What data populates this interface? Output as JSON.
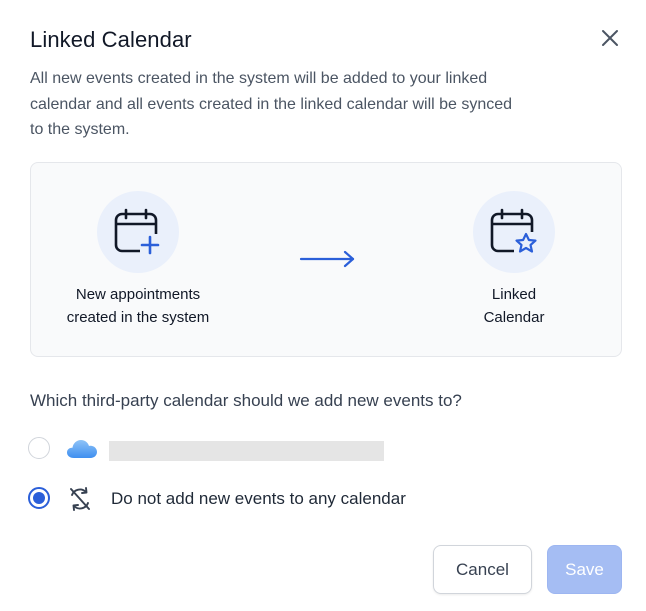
{
  "dialog": {
    "title": "Linked Calendar",
    "close_icon": "close-icon",
    "description_lines": [
      "All new events created in the system will be added to your linked",
      "calendar and all events created in the linked calendar will be synced",
      "to the system."
    ]
  },
  "flow": {
    "source_icon": "calendar-plus-icon",
    "source_label_lines": [
      "New appointments",
      "created in the system"
    ],
    "arrow_icon": "arrow-right-icon",
    "target_icon": "calendar-star-icon",
    "target_label_lines": [
      "Linked",
      "Calendar"
    ]
  },
  "calendar_choice": {
    "question": "Which third-party calendar should we add new events to?",
    "options": [
      {
        "icon": "icloud-icon",
        "label": "",
        "selected": false
      },
      {
        "icon": "sync-off-icon",
        "label": "Do not add new events to any calendar",
        "selected": true
      }
    ]
  },
  "actions": {
    "cancel_label": "Cancel",
    "save_label": "Save",
    "save_enabled": false
  },
  "colors": {
    "accent": "#2b5fd9",
    "icon_circle_bg": "#eaf0fb",
    "save_disabled_bg": "#a5bdf3"
  }
}
